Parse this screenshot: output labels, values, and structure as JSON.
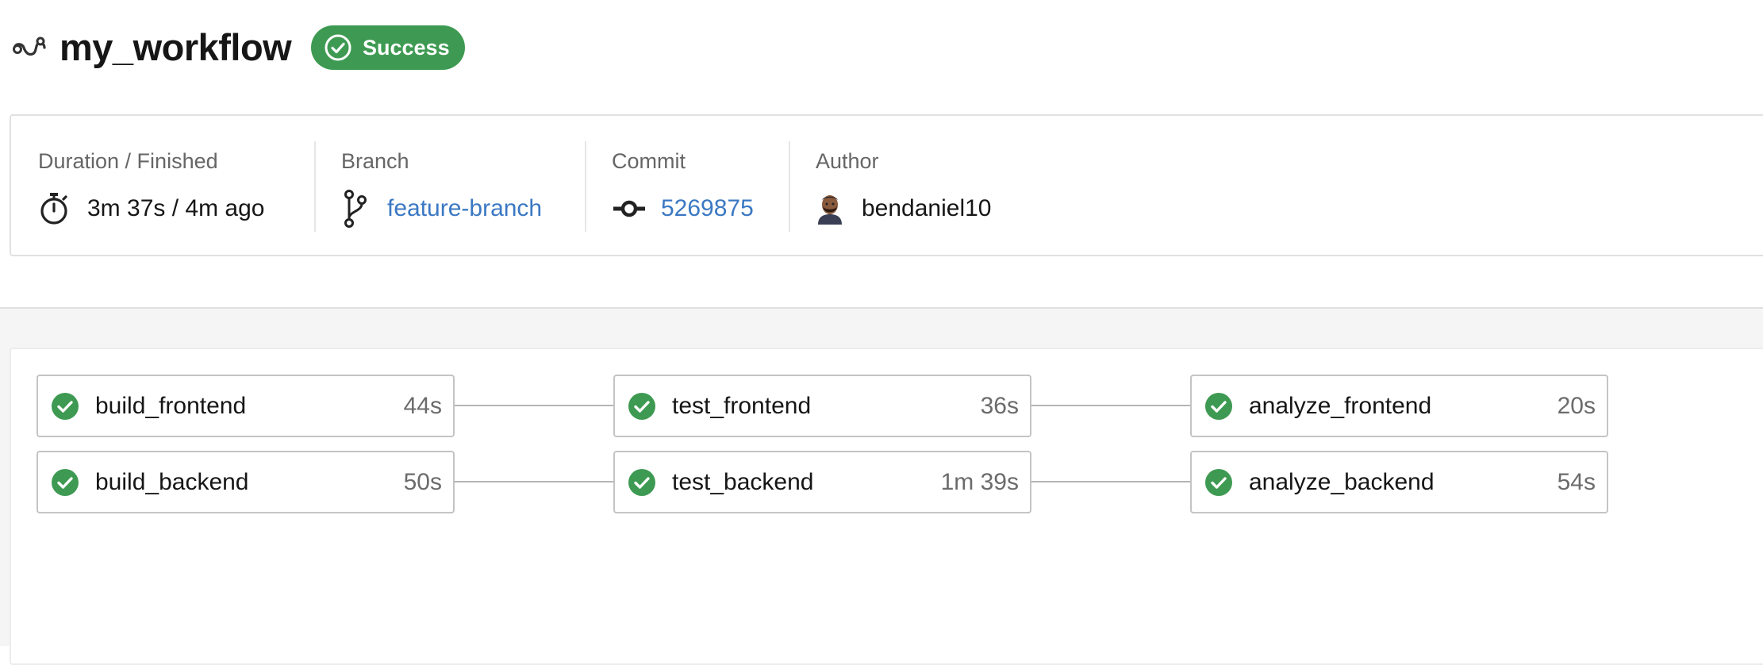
{
  "header": {
    "workflow_icon": "workflow-icon",
    "title": "my_workflow",
    "status": {
      "label": "Success",
      "icon": "check-circle-icon",
      "color": "#3e9a52"
    }
  },
  "summary": {
    "duration": {
      "label": "Duration / Finished",
      "icon": "stopwatch-icon",
      "value": "3m 37s / 4m ago"
    },
    "branch": {
      "label": "Branch",
      "icon": "git-branch-icon",
      "value": "feature-branch"
    },
    "commit": {
      "label": "Commit",
      "icon": "git-commit-icon",
      "value": "5269875"
    },
    "author": {
      "label": "Author",
      "icon": "avatar-emoji",
      "value": "bendaniel10"
    }
  },
  "jobs": {
    "build_frontend": {
      "name": "build_frontend",
      "duration": "44s",
      "status": "success"
    },
    "test_frontend": {
      "name": "test_frontend",
      "duration": "36s",
      "status": "success"
    },
    "analyze_frontend": {
      "name": "analyze_frontend",
      "duration": "20s",
      "status": "success"
    },
    "build_backend": {
      "name": "build_backend",
      "duration": "50s",
      "status": "success"
    },
    "test_backend": {
      "name": "test_backend",
      "duration": "1m 39s",
      "status": "success"
    },
    "analyze_backend": {
      "name": "analyze_backend",
      "duration": "54s",
      "status": "success"
    }
  },
  "colors": {
    "success": "#3e9a52",
    "link": "#3b78c3"
  }
}
